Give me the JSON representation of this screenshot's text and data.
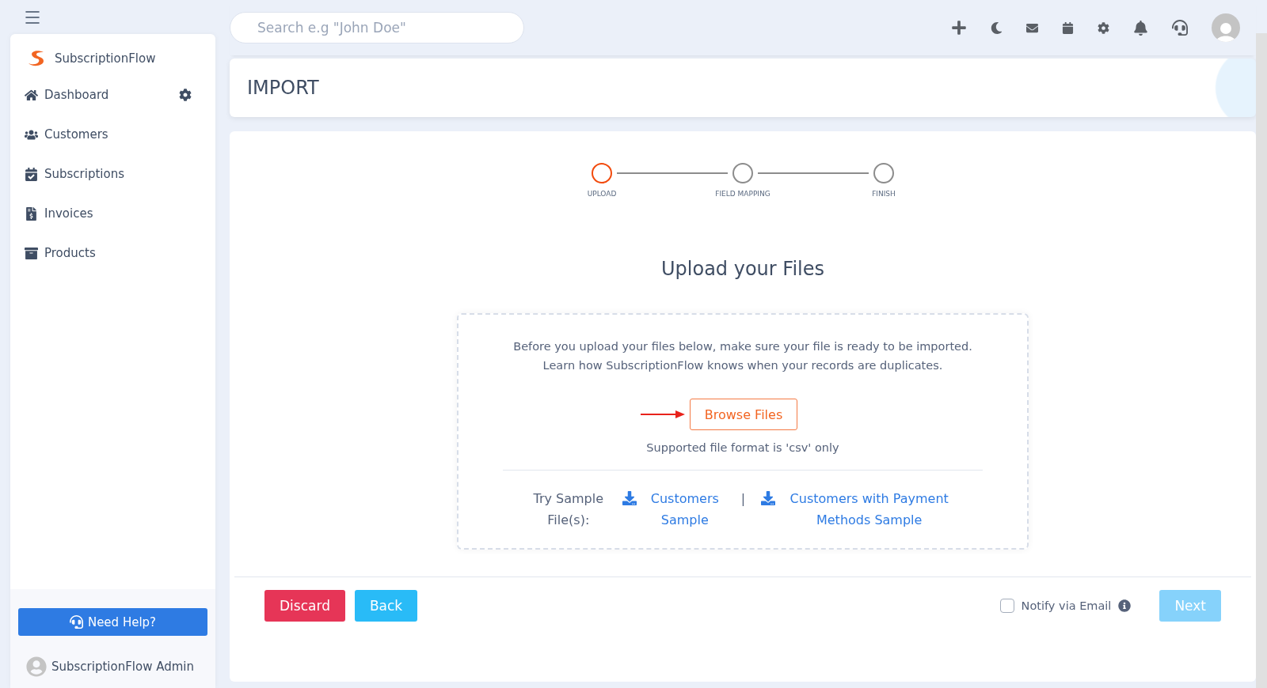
{
  "search": {
    "placeholder": "Search e.g \"John Doe\""
  },
  "brand": {
    "name": "SubscriptionFlow"
  },
  "sidebar": {
    "items": [
      {
        "label": "Dashboard",
        "kind": "dashboard",
        "settings": true
      },
      {
        "label": "Customers",
        "kind": "customers",
        "settings": false
      },
      {
        "label": "Subscriptions",
        "kind": "subscriptions",
        "settings": false
      },
      {
        "label": "Invoices",
        "kind": "invoices",
        "settings": false
      },
      {
        "label": "Products",
        "kind": "products",
        "settings": false
      }
    ],
    "help_button": "Need Help?",
    "user": "SubscriptionFlow Admin"
  },
  "page": {
    "title": "IMPORT"
  },
  "steps": [
    {
      "label": "UPLOAD",
      "selected": true
    },
    {
      "label": "FIELD MAPPING",
      "selected": false
    },
    {
      "label": "FINISH",
      "selected": false
    }
  ],
  "upload": {
    "heading": "Upload your Files",
    "intro": [
      "Before you upload your files below, make sure your file is ready to be imported.",
      "Learn how SubscriptionFlow knows when your records are duplicates."
    ],
    "browse_button": "Browse Files",
    "format_note": "Supported file format is 'csv' only",
    "sample_label": "Try Sample File(s):",
    "separator": "|",
    "samples": [
      "Customers Sample",
      "Customers with Payment Methods Sample"
    ]
  },
  "footer": {
    "discard": "Discard",
    "back": "Back",
    "notify": {
      "label": "Notify via Email",
      "checked": false
    },
    "next": {
      "label": "Next",
      "disabled": true
    }
  }
}
